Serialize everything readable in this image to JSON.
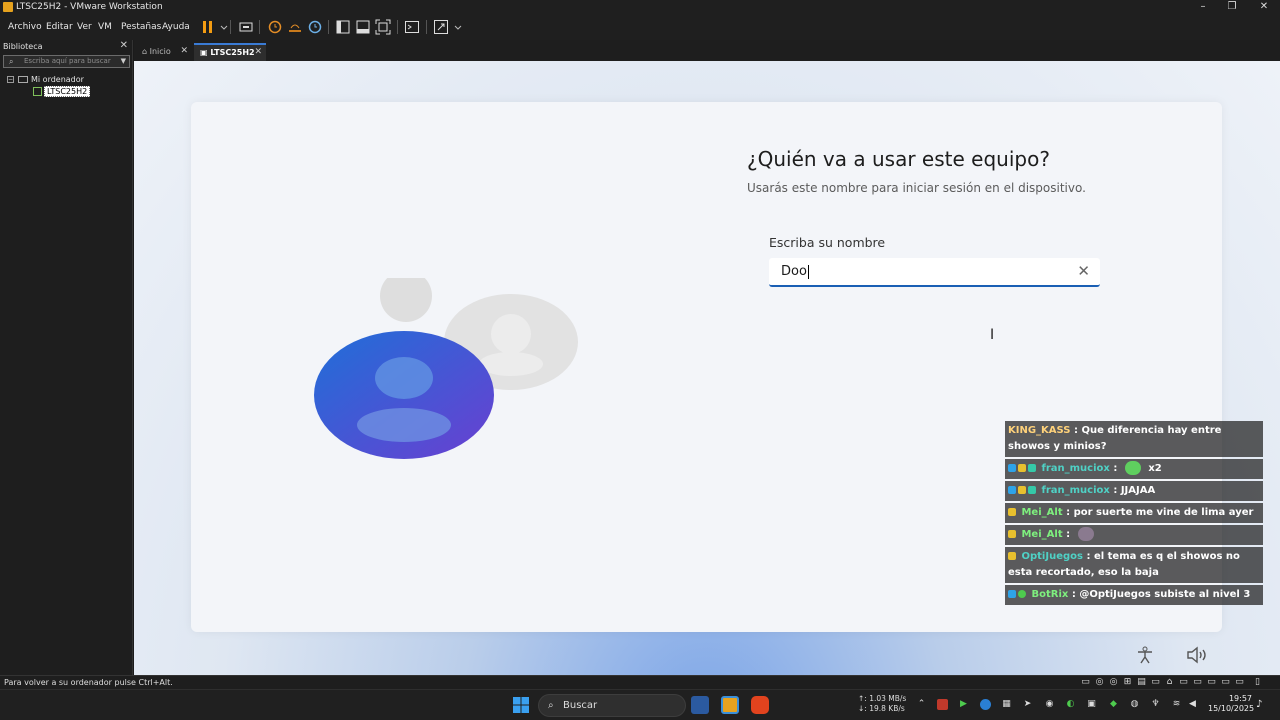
{
  "window": {
    "title": "LTSC25H2 - VMware Workstation",
    "controls": {
      "minimize": "–",
      "restore": "❐",
      "close": "✕"
    }
  },
  "menu": {
    "items": [
      "Archivo",
      "Editar",
      "Ver",
      "VM",
      "Pestañas",
      "Ayuda"
    ]
  },
  "toolbar": {
    "icons": [
      "pause-icon",
      "send-keys-icon",
      "snapshot-icon",
      "revert-snapshot-icon",
      "snapshot-manager-icon",
      "library-view-icon",
      "thumbnail-view-icon",
      "fullscreen-icon",
      "console-icon",
      "stretch-icon"
    ]
  },
  "library": {
    "title": "Biblioteca",
    "close": "✕",
    "search_placeholder": "Escriba aquí para buscar",
    "root": "Mi ordenador",
    "child": "LTSC25H2",
    "expander": "−"
  },
  "tabs": [
    {
      "label": "Inicio",
      "close": "✕"
    },
    {
      "label": "LTSC25H2",
      "close": "✕"
    }
  ],
  "oobe": {
    "title": "¿Quién va a usar este equipo?",
    "subtitle": "Usarás este nombre para iniciar sesión en el dispositivo.",
    "field_label": "Escriba su nombre",
    "field_value": "Doo",
    "clear": "✕"
  },
  "chat": [
    {
      "user": "KING_KASS",
      "text": "Que diferencia hay entre showos y minios?",
      "color": "#ffd27a"
    },
    {
      "user": "fran_muciox",
      "text": "x2",
      "color": "#4fd1c5"
    },
    {
      "user": "fran_muciox",
      "text": "JJAJAA",
      "color": "#4fd1c5"
    },
    {
      "user": "Mei_Alt",
      "text": "por suerte me vine de lima ayer",
      "color": "#7ef07e"
    },
    {
      "user": "Mei_Alt",
      "text": "",
      "color": "#7ef07e"
    },
    {
      "user": "OptiJuegos",
      "text": "el tema es q el showos no esta recortado, eso la baja",
      "color": "#4fd1c5"
    },
    {
      "user": "BotRix",
      "text": "@OptiJuegos subiste al nivel 3",
      "color": "#7ef07e"
    }
  ],
  "chat_sep": ":",
  "statusbar": {
    "message": "Para volver a su ordenador pulse Ctrl+Alt."
  },
  "taskbar": {
    "search_label": "Buscar",
    "net_up": "↑: 1.03 MB/s",
    "net_down": "↓: 19.8 KB/s",
    "time": "19:57",
    "date": "15/10/2025"
  }
}
